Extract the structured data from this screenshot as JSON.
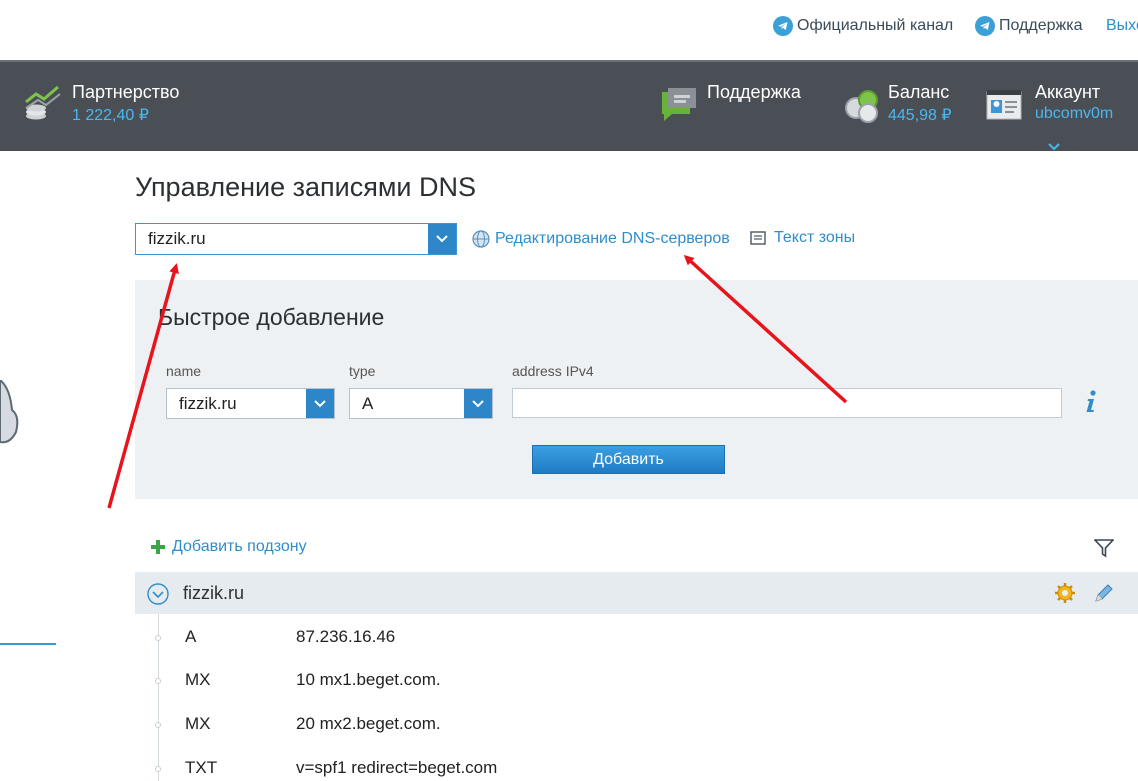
{
  "top_links": {
    "channel": "Официальный канал",
    "support": "Поддержка",
    "exit": "Выход"
  },
  "header": {
    "partnership": {
      "title": "Партнерство",
      "value": "1 222,40 ₽"
    },
    "support": {
      "title": "Поддержка"
    },
    "balance": {
      "title": "Баланс",
      "value": "445,98 ₽"
    },
    "account": {
      "title": "Аккаунт",
      "value": "ubcomv0m"
    }
  },
  "page": {
    "title": "Управление записями DNS",
    "domain_select": "fizzik.ru",
    "edit_dns_link": "Редактирование DNS-серверов",
    "zone_text_link": "Текст зоны"
  },
  "quick_add": {
    "title": "Быстрое добавление",
    "name_label": "name",
    "name_value": "fizzik.ru",
    "type_label": "type",
    "type_value": "A",
    "address_label": "address IPv4",
    "address_value": "",
    "add_button": "Добавить"
  },
  "zone": {
    "add_subzone": "Добавить подзону",
    "name": "fizzik.ru",
    "records": [
      {
        "type": "A",
        "value": "87.236.16.46"
      },
      {
        "type": "MX",
        "value": "10 mx1.beget.com."
      },
      {
        "type": "MX",
        "value": "20 mx2.beget.com."
      },
      {
        "type": "TXT",
        "value": "v=spf1 redirect=beget.com"
      }
    ]
  },
  "colors": {
    "header_bg": "#4a4f56",
    "accent_blue": "#2f8dc9",
    "panel_bg": "#eef1f4",
    "arrow_red": "#e8141b"
  }
}
